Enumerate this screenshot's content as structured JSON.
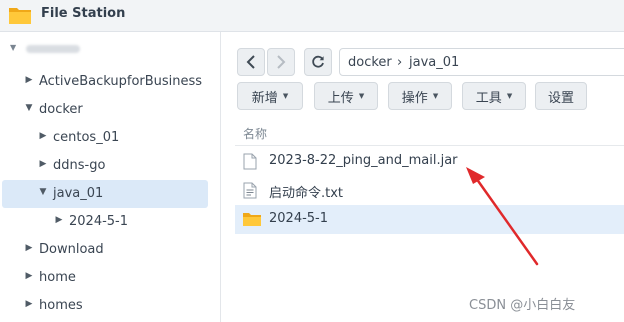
{
  "app": {
    "title": "File Station"
  },
  "sidebar": {
    "items": [
      {
        "label": "ActiveBackupforBusiness",
        "caret": "▶"
      },
      {
        "label": "docker",
        "caret": "▼"
      },
      {
        "label": "centos_01",
        "caret": "▶"
      },
      {
        "label": "ddns-go",
        "caret": "▶"
      },
      {
        "label": "java_01",
        "caret": "▼"
      },
      {
        "label": "2024-5-1",
        "caret": "▶"
      },
      {
        "label": "Download",
        "caret": "▶"
      },
      {
        "label": "home",
        "caret": "▶"
      },
      {
        "label": "homes",
        "caret": "▶"
      }
    ]
  },
  "nav": {
    "back_icon": "chevron-left-icon",
    "forward_icon": "chevron-right-icon",
    "refresh_icon": "refresh-icon"
  },
  "path": {
    "segments": [
      "docker",
      "java_01"
    ],
    "separator": "›"
  },
  "toolbar": {
    "new_label": "新增",
    "upload_label": "上传",
    "action_label": "操作",
    "tools_label": "工具",
    "settings_label": "设置"
  },
  "table": {
    "name_header": "名称",
    "rows": [
      {
        "name": "2023-8-22_ping_and_mail.jar",
        "type": "file"
      },
      {
        "name": "启动命令.txt",
        "type": "text"
      },
      {
        "name": "2024-5-1",
        "type": "folder"
      }
    ]
  },
  "watermark": "CSDN @小白白友",
  "colors": {
    "accent": "#dbe9f8",
    "folder": "#f6b820",
    "arrow": "#e0292b"
  }
}
